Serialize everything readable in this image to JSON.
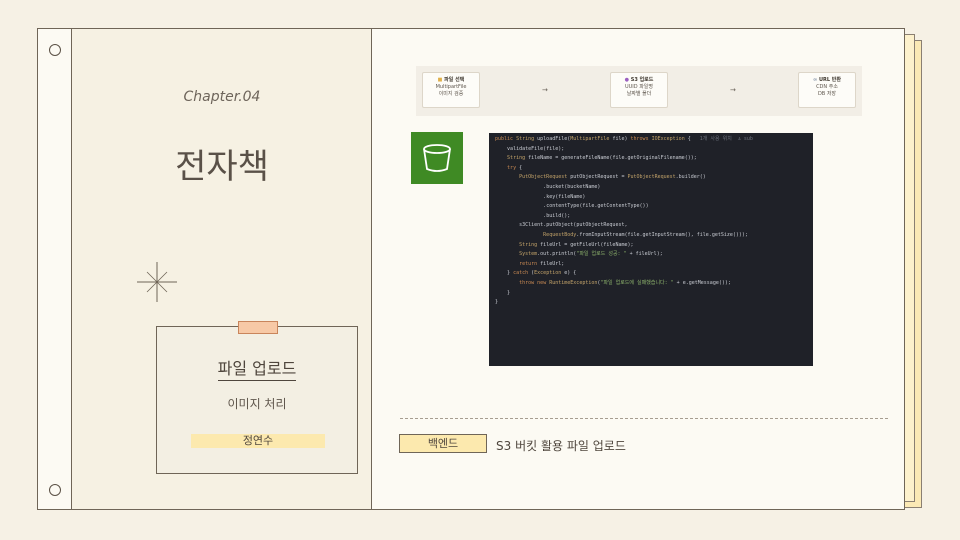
{
  "left_page": {
    "chapter": "Chapter.04",
    "title": "전자책",
    "card": {
      "title": "파일 업로드",
      "subtitle": "이미지 처리",
      "author": "정연수"
    }
  },
  "flow": {
    "steps": [
      {
        "title": "파일 선택",
        "icon": "folder-icon",
        "lines": [
          "MultipartFile",
          "이미지 검증"
        ]
      },
      {
        "title": "S3 업로드",
        "icon": "s3-icon",
        "lines": [
          "UUID 파일명",
          "날짜별 폴더"
        ]
      },
      {
        "title": "URL 반환",
        "icon": "link-icon",
        "lines": [
          "CDN 주소",
          "DB 저장"
        ]
      }
    ],
    "arrow": "→"
  },
  "code": {
    "hint": "1개 사용 위치  ⚓ sub",
    "lines": [
      "public String uploadFile(MultipartFile file) throws IOException {",
      "    validateFile(file);",
      "",
      "    String fileName = generateFileName(file.getOriginalFilename());",
      "",
      "    try {",
      "        PutObjectRequest putObjectRequest = PutObjectRequest.builder()",
      "                .bucket(bucketName)",
      "                .key(fileName)",
      "                .contentType(file.getContentType())",
      "                .build();",
      "",
      "        s3Client.putObject(putObjectRequest,",
      "                RequestBody.fromInputStream(file.getInputStream(), file.getSize()));",
      "",
      "        String fileUrl = getFileUrl(fileName);",
      "        System.out.println(\"파일 업로드 성공: \" + fileUrl);",
      "",
      "        return fileUrl;",
      "",
      "    } catch (Exception e) {",
      "        throw new RuntimeException(\"파일 업로드에 실패했습니다: \" + e.getMessage());",
      "    }",
      "}"
    ]
  },
  "footer": {
    "tag": "백엔드",
    "description": "S3 버킷 활용 파일 업로드"
  },
  "colors": {
    "background": "#f6f1e5",
    "accent_yellow": "#fce9ae",
    "tape": "#f7c9a6",
    "s3_green": "#3f8a24",
    "code_bg": "#1f2128"
  }
}
